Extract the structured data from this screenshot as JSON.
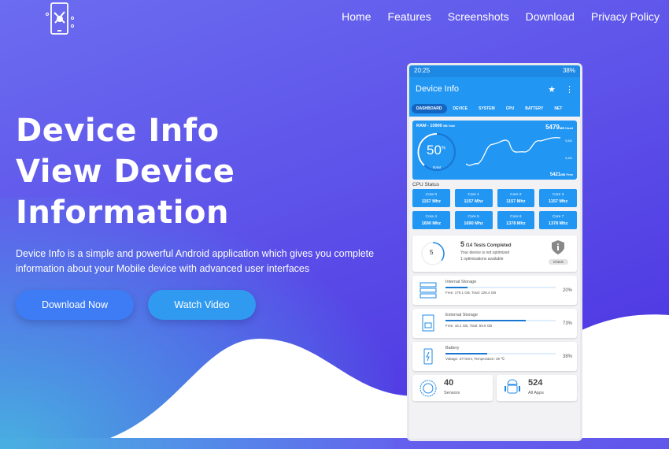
{
  "nav": {
    "items": [
      "Home",
      "Features",
      "Screenshots",
      "Download",
      "Privacy Policy"
    ]
  },
  "hero": {
    "title_lines": [
      "Device Info",
      "View Device",
      "Information"
    ],
    "description": "Device Info is a simple and powerful Android application which gives you complete information about your Mobile device with advanced user interfaces",
    "download_label": "Download Now",
    "video_label": "Watch Video"
  },
  "phone": {
    "time": "20:25",
    "battery": "38%",
    "app_title": "Device Info",
    "tabs": [
      "DASHBOARD",
      "DEVICE",
      "SYSTEM",
      "CPU",
      "BATTERY",
      "NET"
    ],
    "ram": {
      "label": "RAM - 10900",
      "total_unit": "MB Total",
      "used": "5479",
      "used_unit": "MB Used",
      "free": "5421",
      "free_unit": "MB Free",
      "percent": "50",
      "percent_sign": "%",
      "gauge_label": "RAM",
      "axis_top": "5,500",
      "axis_bottom": "5,400"
    },
    "cpu_title": "CPU Status",
    "cores": [
      {
        "name": "Core 0",
        "freq": "1157 Mhz"
      },
      {
        "name": "Core 1",
        "freq": "1157 Mhz"
      },
      {
        "name": "Core 2",
        "freq": "1157 Mhz"
      },
      {
        "name": "Core 3",
        "freq": "1157 Mhz"
      },
      {
        "name": "Core 4",
        "freq": "1690 Mhz"
      },
      {
        "name": "Core 5",
        "freq": "1690 Mhz"
      },
      {
        "name": "Core 6",
        "freq": "1378 Mhz"
      },
      {
        "name": "Core 7",
        "freq": "1378 Mhz"
      }
    ],
    "tests": {
      "count": "5",
      "total": "/14 Tests Completed",
      "line1": "Your device is not optimized",
      "line2": "1 optimizations available",
      "check": "Check",
      "progress": 0.357
    },
    "storage": [
      {
        "title": "Internal Storage",
        "detail": "Free: 179.1 GB,  Total: 226.4 GB",
        "percent": "20%",
        "value": 20
      },
      {
        "title": "External Storage",
        "detail": "Free: 16.1 GB,  Total: 59.6 GB",
        "percent": "73%",
        "value": 73
      },
      {
        "title": "Battery",
        "detail": "Voltage: 3773mV,  Temperature: 39 ℃",
        "percent": "38%",
        "value": 38
      }
    ],
    "sensors": {
      "count": "40",
      "label": "Sensors"
    },
    "apps": {
      "count": "524",
      "label": "All Apps"
    }
  },
  "colors": {
    "accent": "#2196f3",
    "button1": "#3d7cf5",
    "button2": "#2f9af0"
  }
}
